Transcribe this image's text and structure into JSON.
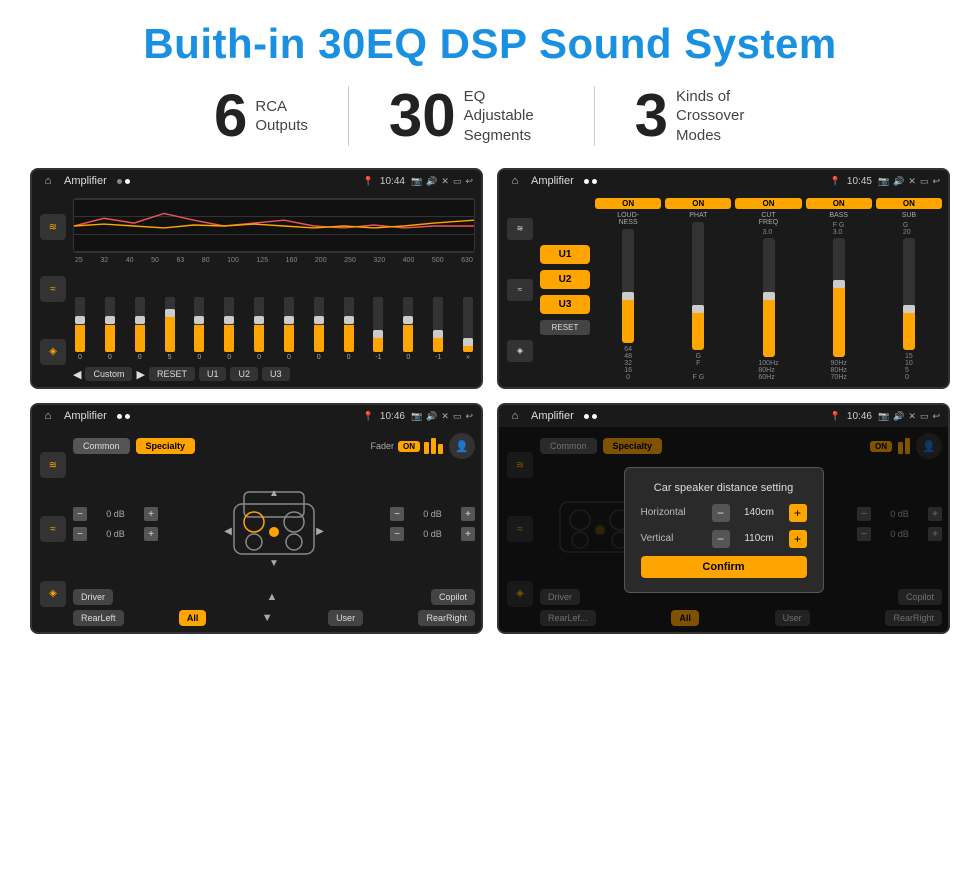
{
  "title": "Buith-in 30EQ DSP Sound System",
  "stats": [
    {
      "number": "6",
      "label": "RCA\nOutputs"
    },
    {
      "number": "30",
      "label": "EQ Adjustable\nSegments"
    },
    {
      "number": "3",
      "label": "Kinds of\nCrossover Modes"
    }
  ],
  "screens": {
    "eq": {
      "title": "Amplifier",
      "time": "10:44",
      "chart_label": "EQ Chart",
      "freqs": [
        "25",
        "32",
        "40",
        "50",
        "63",
        "80",
        "100",
        "125",
        "160",
        "200",
        "250",
        "320",
        "400",
        "500",
        "630"
      ],
      "slider_vals": [
        "0",
        "0",
        "0",
        "5",
        "0",
        "0",
        "0",
        "0",
        "0",
        "0",
        "-1",
        "0",
        "-1"
      ],
      "controls": [
        "Custom",
        "RESET",
        "U1",
        "U2",
        "U3"
      ]
    },
    "crossover": {
      "title": "Amplifier",
      "time": "10:45",
      "presets": [
        "U1",
        "U2",
        "U3"
      ],
      "channels": [
        "LOUDNESS",
        "PHAT",
        "CUT FREQ",
        "BASS",
        "SUB"
      ],
      "reset": "RESET"
    },
    "speaker": {
      "title": "Amplifier",
      "time": "10:46",
      "tabs": [
        "Common",
        "Specialty"
      ],
      "fader": "Fader",
      "fader_on": "ON",
      "controls": {
        "top_left": "0 dB",
        "bottom_left": "0 dB",
        "top_right": "0 dB",
        "bottom_right": "0 dB"
      },
      "buttons": [
        "Driver",
        "RearLeft",
        "All",
        "User",
        "RearRight",
        "Copilot"
      ]
    },
    "dialog": {
      "title": "Amplifier",
      "time": "10:46",
      "dialog_title": "Car speaker distance setting",
      "horizontal_label": "Horizontal",
      "horizontal_val": "140cm",
      "vertical_label": "Vertical",
      "vertical_val": "110cm",
      "confirm": "Confirm",
      "tabs": [
        "Common",
        "Specialty"
      ],
      "fader_on": "ON",
      "controls": {
        "top_right": "0 dB",
        "bottom_right": "0 dB"
      },
      "buttons": [
        "Driver",
        "RearLef...",
        "All",
        "User",
        "RearRight",
        "Copilot"
      ]
    }
  },
  "icons": {
    "home": "⌂",
    "back": "↩",
    "equalizer": "≋",
    "waveform": "≈",
    "speaker": "◈"
  }
}
